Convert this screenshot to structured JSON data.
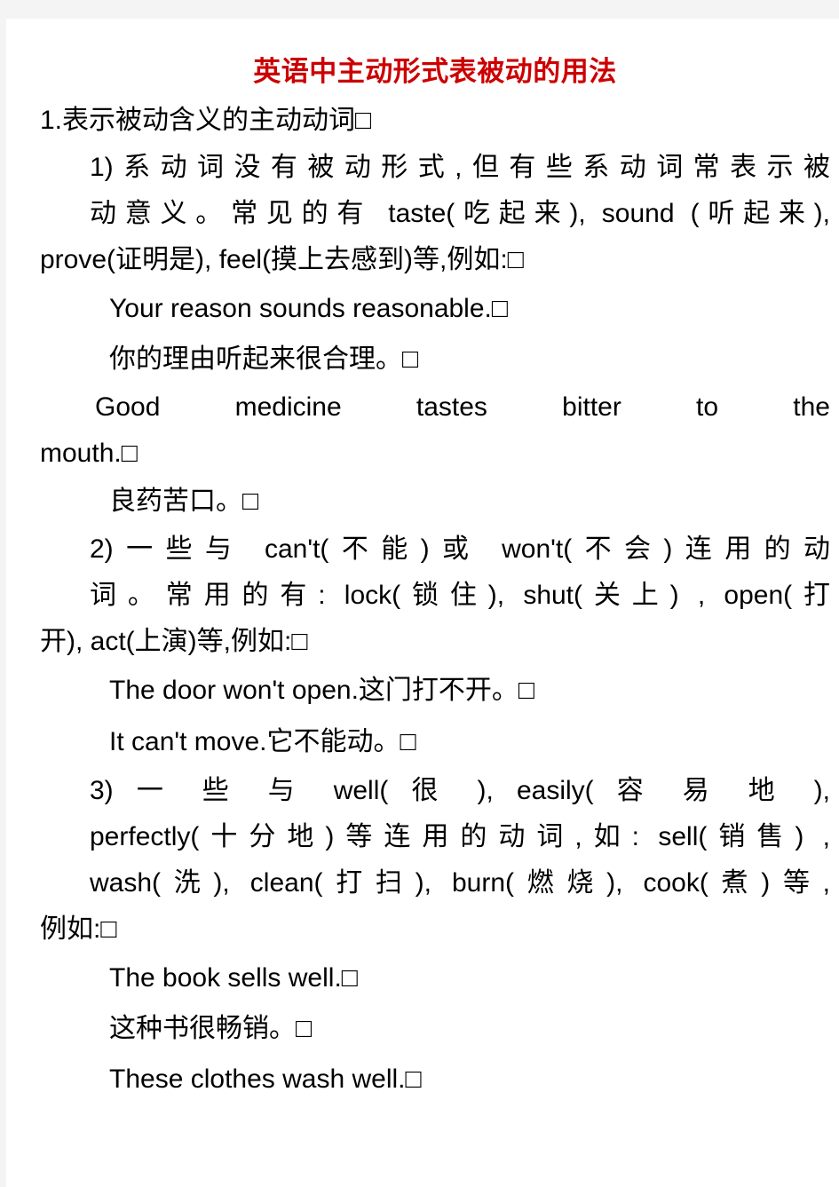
{
  "document": {
    "title": "英语中主动形式表被动的用法",
    "title_color": "#cc0000",
    "page_background": "#ffffff",
    "canvas_background": "#f4f4f4",
    "missing_glyph_char": "□"
  },
  "body": {
    "section1_heading": "1.表示被动含义的主动动词□",
    "item1": {
      "text": "1)系动词没有被动形式,但有些系动词常表示被动意义。常见的有 taste(吃起来), sound (听起来), prove(证明是), feel(摸上去感到)等,例如:□",
      "line1": "1)系动词没有被动形式,但有些系动词常表示被",
      "line2": "动意义。常见的有 taste(吃起来), sound (听起来),",
      "line3": "prove(证明是), feel(摸上去感到)等,例如:□"
    },
    "example1_en": "Your reason sounds reasonable.□",
    "example1_cn": "你的理由听起来很合理。□",
    "example2_en_line1": "Good medicine tastes bitter to the",
    "example2_en_line2": "mouth.□",
    "example2_cn": "良药苦口。□",
    "item2": {
      "line1": "2)一些与 can't(不能)或 won't(不会)连用的动",
      "line2": "词。常用的有: lock(锁住), shut(关上) , open(打",
      "line3": "开), act(上演)等,例如:□"
    },
    "example3": "The door won't open.这门打不开。□",
    "example4": "It can't move.它不能动。□",
    "item3": {
      "line1": "3) 一 些 与  well( 很 ),  easily( 容 易 地 ),",
      "line2": "perfectly(十分地)等连用的动词,如: sell(销售) ,",
      "line3": "wash(洗), clean(打扫), burn(燃烧), cook(煮)等,",
      "line4": "例如:□"
    },
    "example5_en": "The book sells well.□",
    "example5_cn": "这种书很畅销。□",
    "example6_en": "These clothes wash well.□"
  }
}
